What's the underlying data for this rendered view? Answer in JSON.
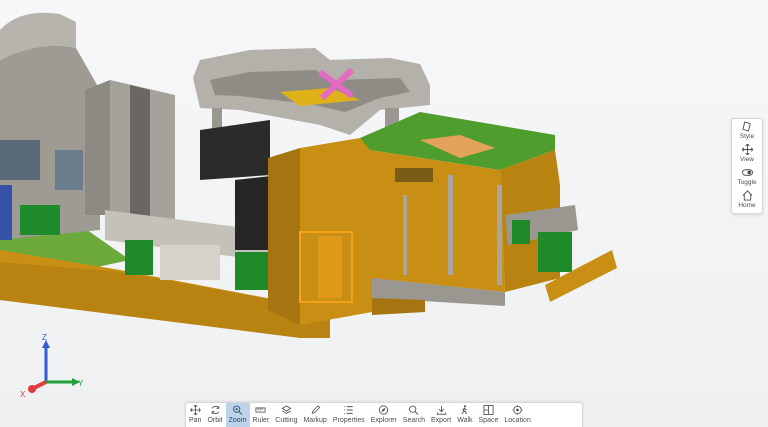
{
  "viewer": {
    "background": "#f2f4f6",
    "accent": "#4f7fb8"
  },
  "side_panel": {
    "items": [
      {
        "label": "Style",
        "icon": "style-icon"
      },
      {
        "label": "View",
        "icon": "view-icon"
      },
      {
        "label": "Toggle",
        "icon": "toggle-icon"
      },
      {
        "label": "Home",
        "icon": "home-icon"
      }
    ]
  },
  "axes": {
    "z": "Z",
    "y": "Y",
    "x": "X",
    "colors": {
      "x": "#e23b3b",
      "y": "#21a03c",
      "z": "#2f5fd6"
    }
  },
  "toolbar": {
    "active": "Zoom",
    "items": [
      {
        "label": "Pan",
        "icon": "pan-icon"
      },
      {
        "label": "Orbit",
        "icon": "orbit-icon"
      },
      {
        "label": "Zoom",
        "icon": "zoom-icon"
      },
      {
        "label": "Ruler",
        "icon": "ruler-icon"
      },
      {
        "label": "Cutting",
        "icon": "cutting-icon"
      },
      {
        "label": "Markup",
        "icon": "markup-icon"
      },
      {
        "label": "Properties",
        "icon": "properties-icon"
      },
      {
        "label": "Explorer",
        "icon": "explorer-icon"
      },
      {
        "label": "Search",
        "icon": "search-icon"
      },
      {
        "label": "Export",
        "icon": "export-icon"
      },
      {
        "label": "Walk",
        "icon": "walk-icon"
      },
      {
        "label": "Space",
        "icon": "space-icon"
      },
      {
        "label": "Location",
        "icon": "location-icon"
      }
    ]
  },
  "model_colors": {
    "facade": "#c98f14",
    "facade_dark": "#a67410",
    "concrete": "#a9a6a0",
    "concrete_dark": "#7b7873",
    "roof_green": "#4f9d2d",
    "panel_green": "#1f8a2a",
    "dark_glass": "#2b2b2b",
    "highlight": "#f3a21a",
    "pink": "#e56ac2"
  }
}
